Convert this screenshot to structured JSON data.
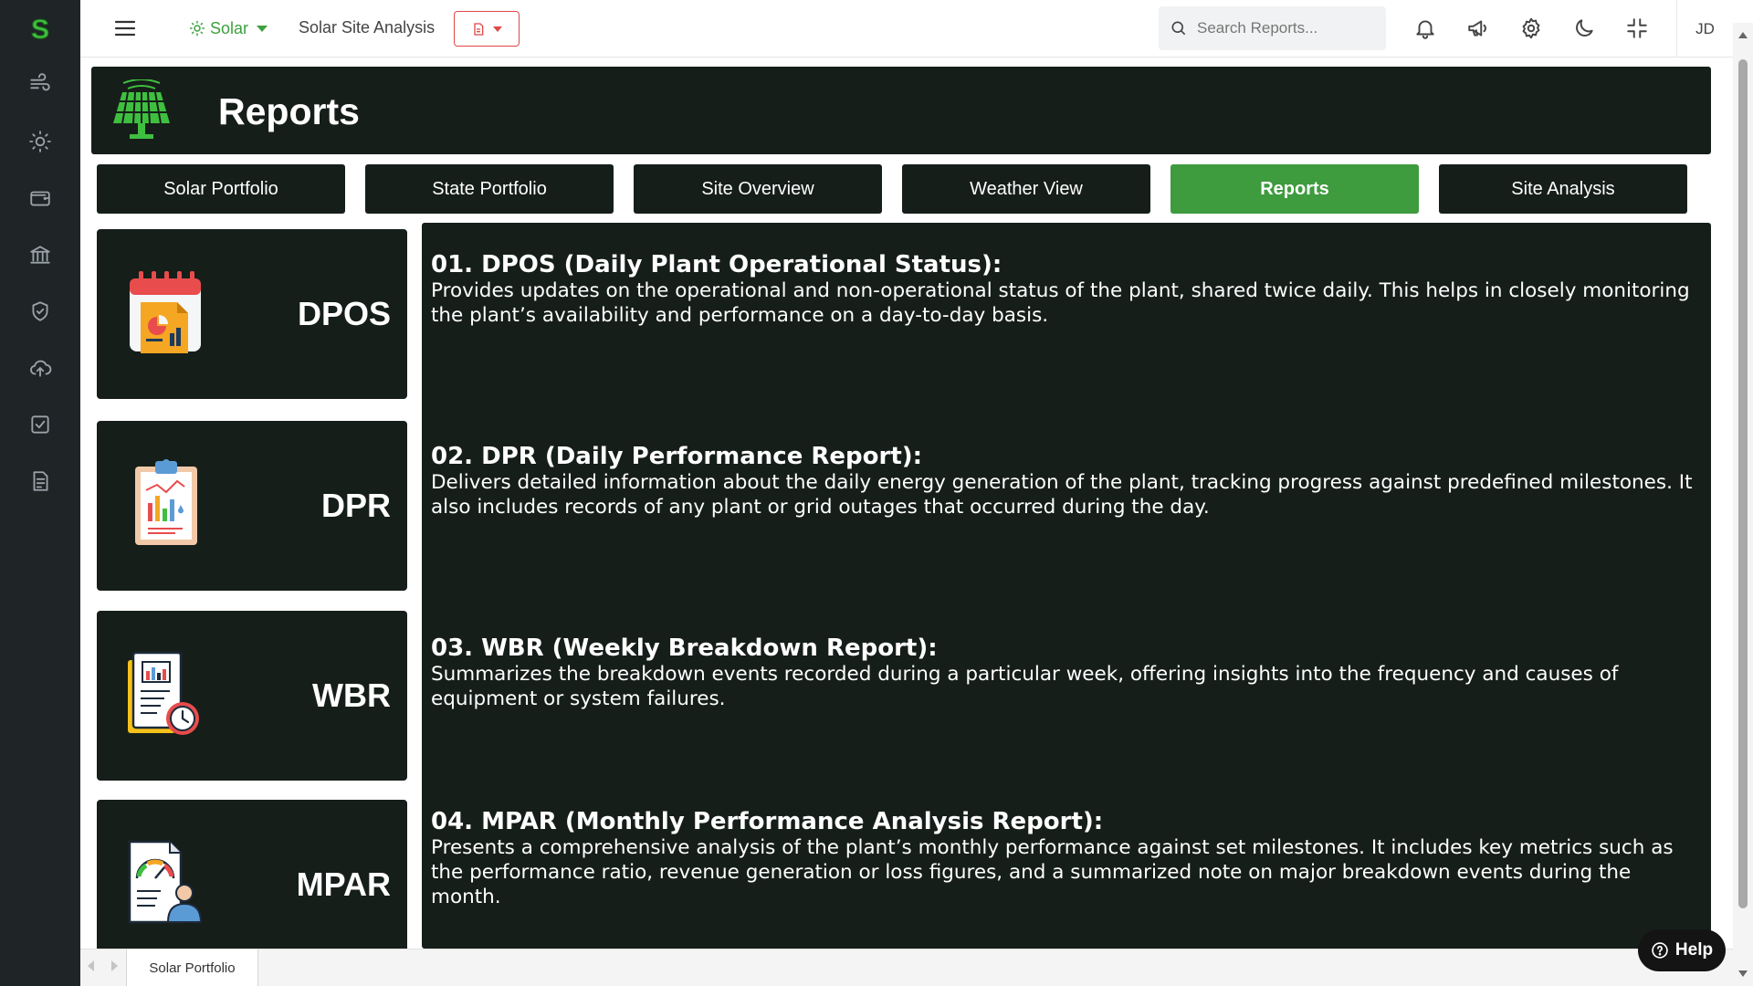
{
  "app": {
    "logo_letter": "S",
    "sidebar_icons": [
      "wind-icon",
      "sun-icon",
      "wallet-icon",
      "bank-icon",
      "shield-check-icon",
      "cloud-upload-icon",
      "checkbox-icon",
      "document-list-icon"
    ]
  },
  "topbar": {
    "energy_type": "Solar",
    "site_name": "Solar Site Analysis",
    "search_placeholder": "Search Reports...",
    "user_initials": "JD"
  },
  "header": {
    "title": "Reports"
  },
  "tabs": [
    {
      "label": "Solar Portfolio",
      "active": false
    },
    {
      "label": "State Portfolio",
      "active": false
    },
    {
      "label": "Site Overview",
      "active": false
    },
    {
      "label": "Weather View",
      "active": false
    },
    {
      "label": "Reports",
      "active": true
    },
    {
      "label": "Site Analysis",
      "active": false
    }
  ],
  "reports": [
    {
      "code": "DPOS",
      "title": "01. DPOS (Daily Plant Operational Status):",
      "description": "Provides updates on the operational and non-operational status of the plant, shared twice daily. This helps in closely monitoring the plant’s availability and performance on a day-to-day basis."
    },
    {
      "code": "DPR",
      "title": "02. DPR (Daily Performance Report):",
      "description": "Delivers detailed information about the daily energy generation of the plant, tracking progress against predefined milestones. It also includes records of any plant or grid outages that occurred during the day."
    },
    {
      "code": "WBR",
      "title": "03. WBR (Weekly Breakdown Report):",
      "description": "Summarizes the breakdown events recorded during a particular week, offering insights into the frequency and causes of equipment or system failures."
    },
    {
      "code": "MPAR",
      "title": "04. MPAR (Monthly Performance Analysis Report):",
      "description": "Presents a comprehensive analysis of the plant’s monthly performance against set milestones. It includes key metrics such as the performance ratio, revenue generation or loss figures, and a summarized note on major breakdown events during the month."
    }
  ],
  "bottom_bar": {
    "open_tab": "Solar Portfolio"
  },
  "help": {
    "label": "Help"
  },
  "colors": {
    "accent_green": "#3e9b3e",
    "panel_bg": "#161e1a",
    "sidebar_bg": "#1f2527",
    "doc_button_red": "#e04848"
  }
}
